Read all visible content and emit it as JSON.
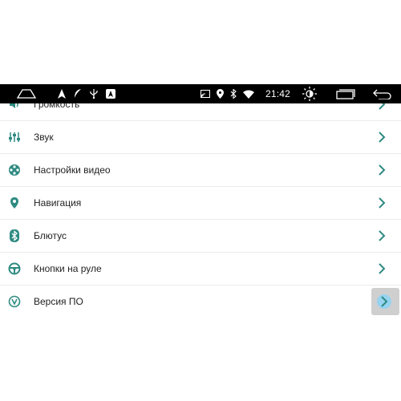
{
  "statusbar": {
    "time": "21:42",
    "left_icons": [
      "home-outline-icon",
      "navigation-arrow-icon",
      "leaf-icon",
      "usb-icon",
      "carplay-icon"
    ],
    "right_icons": [
      "cast-icon",
      "location-icon",
      "bluetooth-icon",
      "wifi-icon",
      "brightness-icon",
      "recent-apps-icon",
      "back-icon"
    ]
  },
  "colors": {
    "accent": "#2e8a82",
    "statusbar_bg": "#000000",
    "highlight": "#cfcfcf",
    "highlight_dot": "#8fd3f4"
  },
  "settings": {
    "items": [
      {
        "label": "Громкость",
        "icon": "volume-icon"
      },
      {
        "label": "Звук",
        "icon": "equalizer-icon"
      },
      {
        "label": "Настройки видео",
        "icon": "video-reel-icon"
      },
      {
        "label": "Навигация",
        "icon": "map-pin-icon"
      },
      {
        "label": "Блютус",
        "icon": "bluetooth-icon"
      },
      {
        "label": "Кнопки на руле",
        "icon": "steering-wheel-icon"
      },
      {
        "label": "Версия ПО",
        "icon": "version-icon"
      }
    ]
  }
}
